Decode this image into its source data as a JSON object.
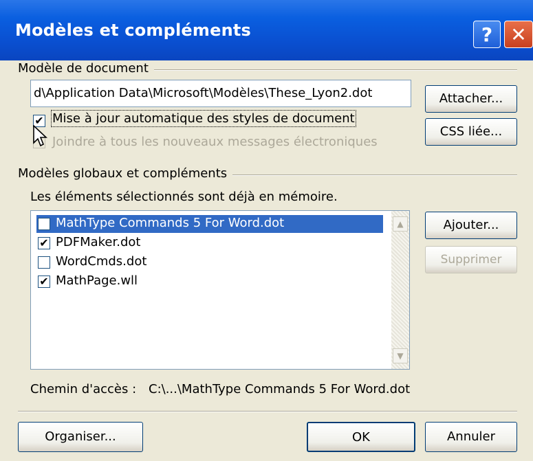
{
  "window": {
    "title": "Modèles et compléments",
    "help_icon": "?",
    "close_icon": "✕"
  },
  "document_template": {
    "group_label": "Modèle de document",
    "path_value": "d\\Application Data\\Microsoft\\Modèles\\These_Lyon2.dot",
    "attach_button": "Attacher...",
    "css_button": "CSS liée...",
    "auto_update_label": "Mise à jour automatique des styles de document",
    "auto_update_checked": true,
    "attach_email_label": "Joindre à tous les nouveaux messages électroniques",
    "attach_email_checked": false
  },
  "global_templates": {
    "group_label": "Modèles globaux et compléments",
    "note": "Les éléments sélectionnés sont déjà en mémoire.",
    "items": [
      {
        "label": "MathType Commands 5 For Word.dot",
        "checked": true,
        "selected": true
      },
      {
        "label": "PDFMaker.dot",
        "checked": true,
        "selected": false
      },
      {
        "label": "WordCmds.dot",
        "checked": false,
        "selected": false
      },
      {
        "label": "MathPage.wll",
        "checked": true,
        "selected": false
      }
    ],
    "add_button": "Ajouter...",
    "remove_button": "Supprimer",
    "path_label": "Chemin d'accès :",
    "path_value": "C:\\...\\MathType Commands 5 For Word.dot"
  },
  "footer": {
    "organize_button": "Organiser...",
    "ok_button": "OK",
    "cancel_button": "Annuler"
  }
}
